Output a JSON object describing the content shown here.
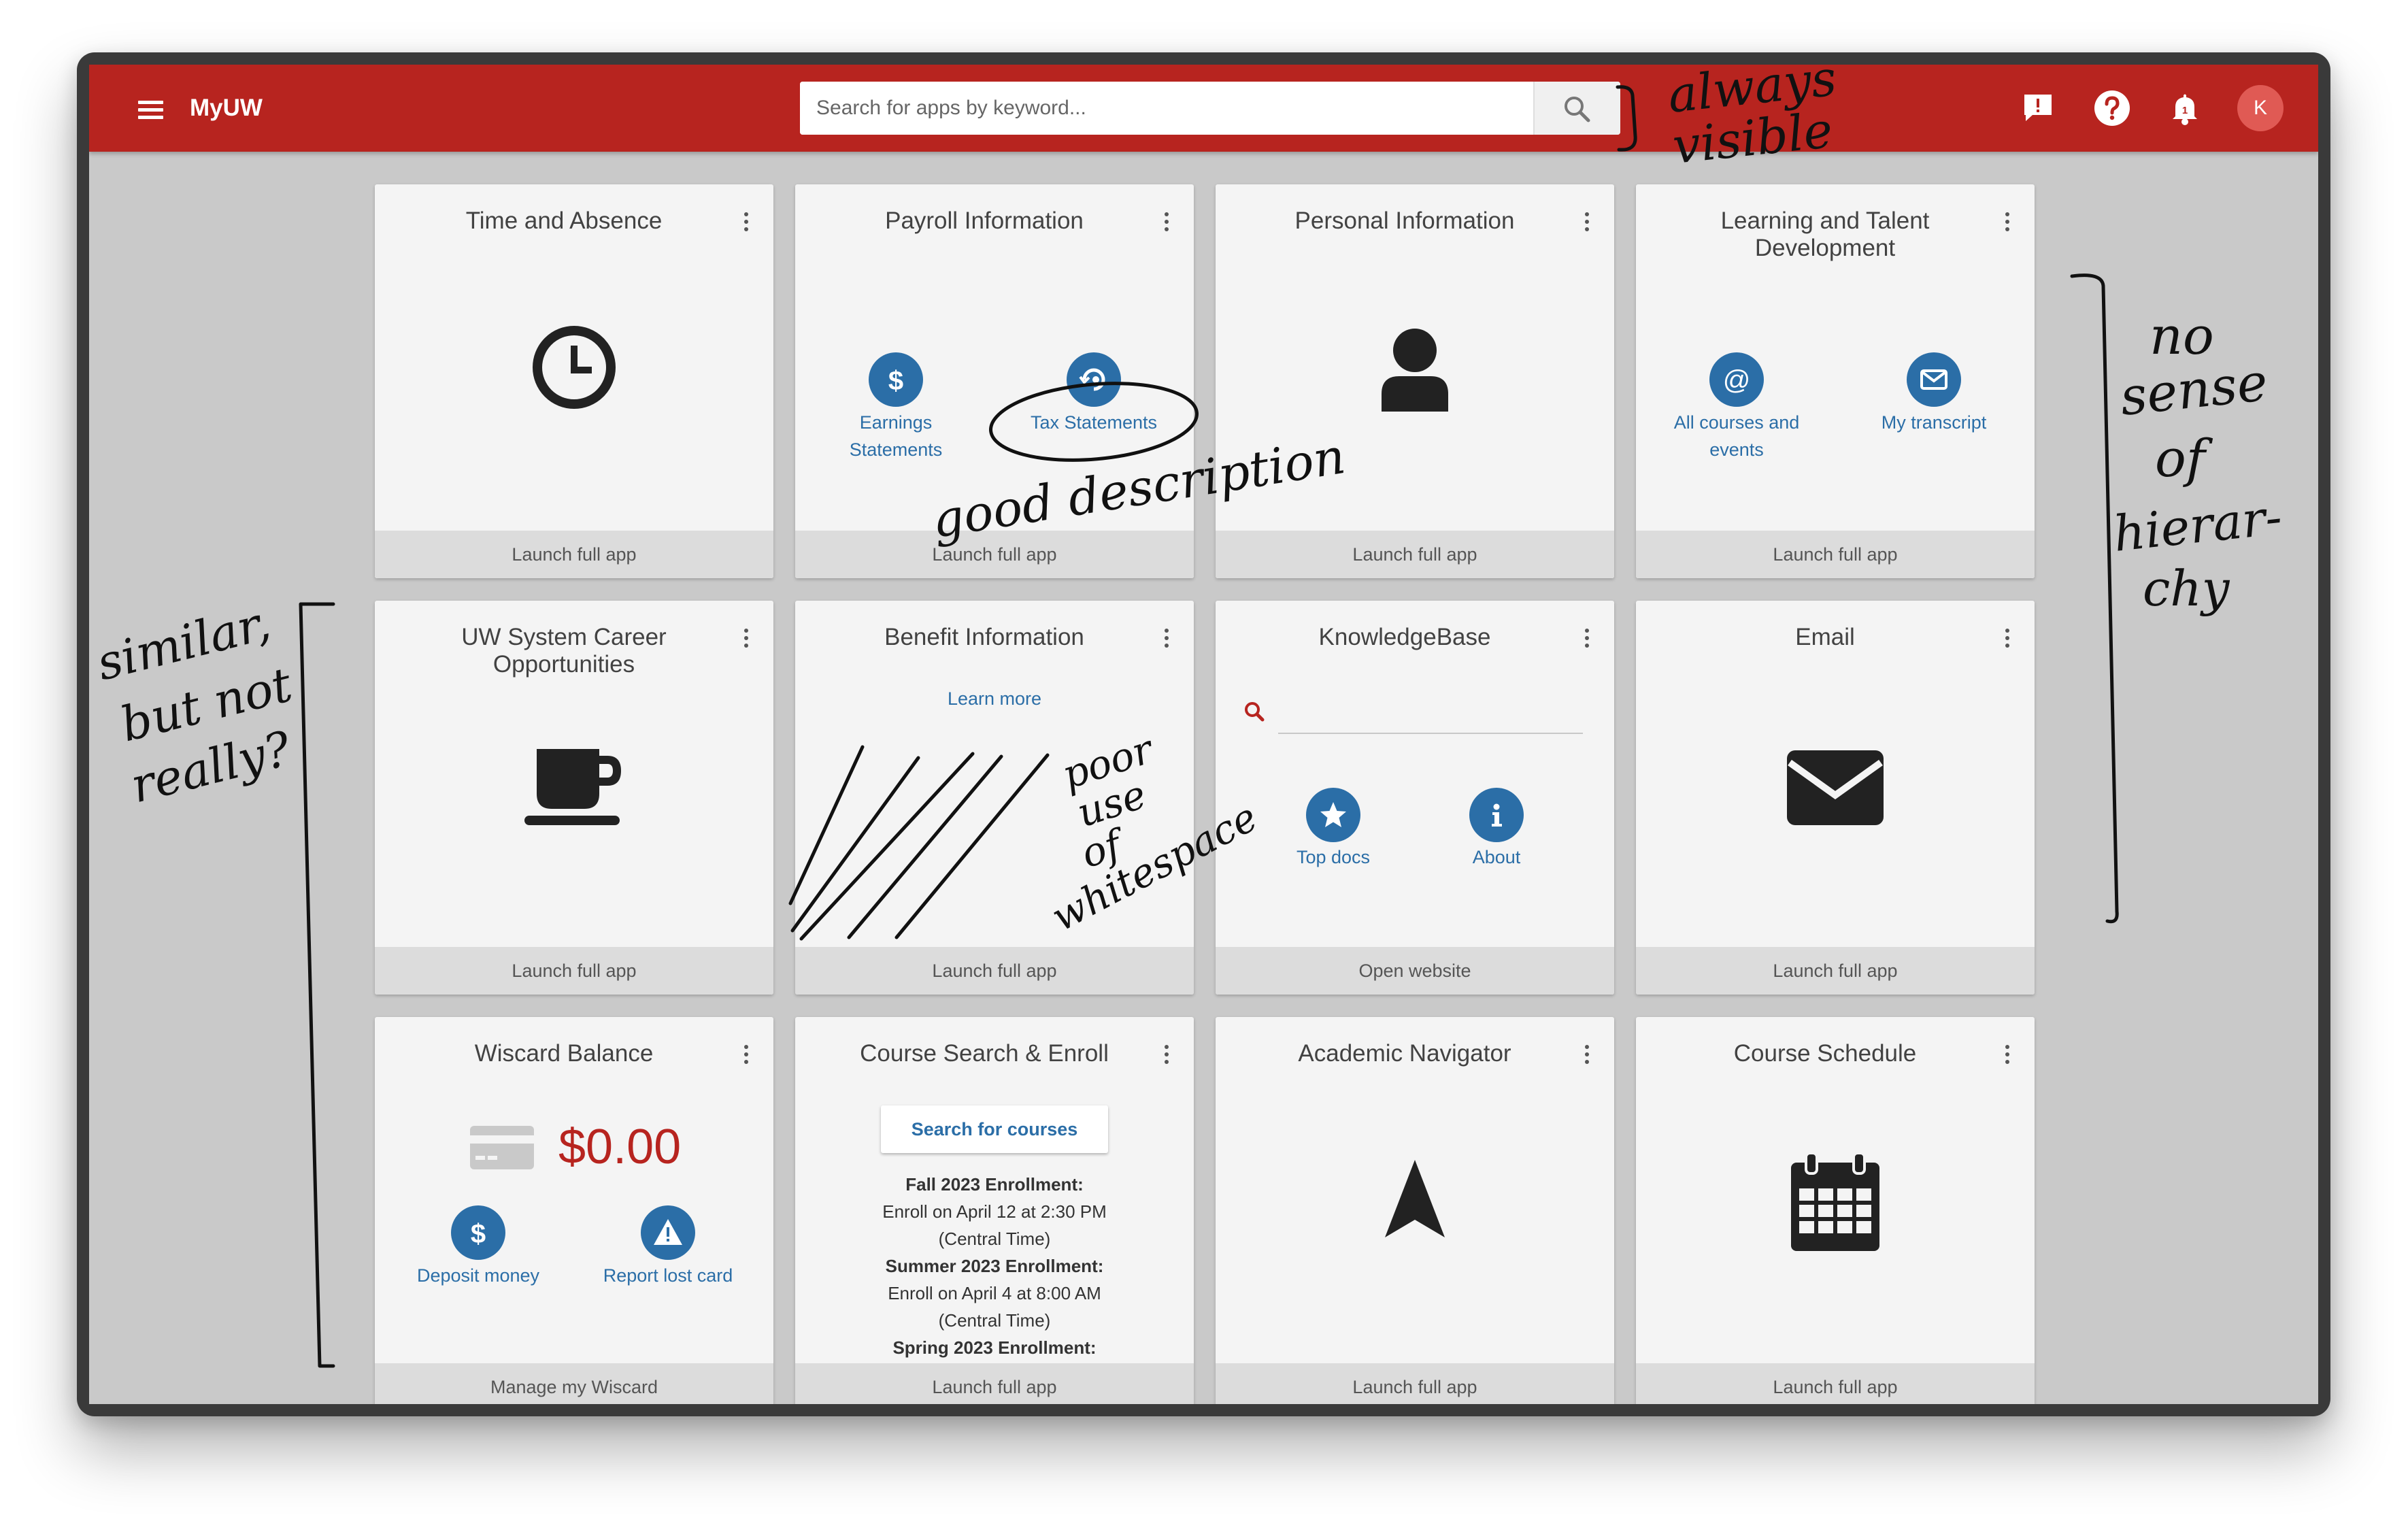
{
  "header": {
    "brand": "MyUW",
    "search_placeholder": "Search for apps by keyword...",
    "avatar_initial": "K",
    "accent_color": "#b7241f"
  },
  "cards": {
    "time_absence": {
      "title": "Time and Absence",
      "footer": "Launch full app"
    },
    "payroll": {
      "title": "Payroll Information",
      "earnings": "Earnings Statements",
      "tax": "Tax Statements",
      "footer": "Launch full app"
    },
    "personal": {
      "title": "Personal Information",
      "footer": "Launch full app"
    },
    "learning": {
      "title": "Learning and Talent Development",
      "courses": "All courses and events",
      "transcript": "My transcript",
      "footer": "Launch full app"
    },
    "career": {
      "title": "UW System Career Opportunities",
      "footer": "Launch full app"
    },
    "benefit": {
      "title": "Benefit Information",
      "learn_more": "Learn more",
      "footer": "Launch full app"
    },
    "knowledgebase": {
      "title": "KnowledgeBase",
      "top_docs": "Top docs",
      "about": "About",
      "footer": "Open website"
    },
    "email": {
      "title": "Email",
      "footer": "Launch full app"
    },
    "wiscard": {
      "title": "Wiscard Balance",
      "balance": "$0.00",
      "deposit": "Deposit money",
      "report": "Report lost card",
      "footer": "Manage my Wiscard",
      "balance_color": "#b7241f"
    },
    "course_search": {
      "title": "Course Search & Enroll",
      "button": "Search for courses",
      "fall_label": "Fall 2023 Enrollment:",
      "fall_date": "Enroll on April 12 at 2:30 PM",
      "fall_tz": "(Central Time)",
      "summer_label": "Summer 2023 Enrollment:",
      "summer_date": "Enroll on April 4 at 8:00 AM",
      "summer_tz": "(Central Time)",
      "spring_label": "Spring 2023 Enrollment:",
      "footer": "Launch full app"
    },
    "academic_nav": {
      "title": "Academic Navigator",
      "footer": "Launch full app"
    },
    "course_schedule": {
      "title": "Course Schedule",
      "footer": "Launch full app"
    }
  },
  "annotations": {
    "always_visible_1": "always",
    "always_visible_2": "visible",
    "good_description": "good description",
    "poor_use_1": "poor",
    "poor_use_2": "use",
    "poor_use_3": "of",
    "poor_use_4": "whitespace",
    "similar_1": "similar,",
    "similar_2": "but not",
    "similar_3": "really?",
    "hierarchy_1": "no",
    "hierarchy_2": "sense",
    "hierarchy_3": "of",
    "hierarchy_4": "hierar-",
    "hierarchy_5": "chy"
  }
}
